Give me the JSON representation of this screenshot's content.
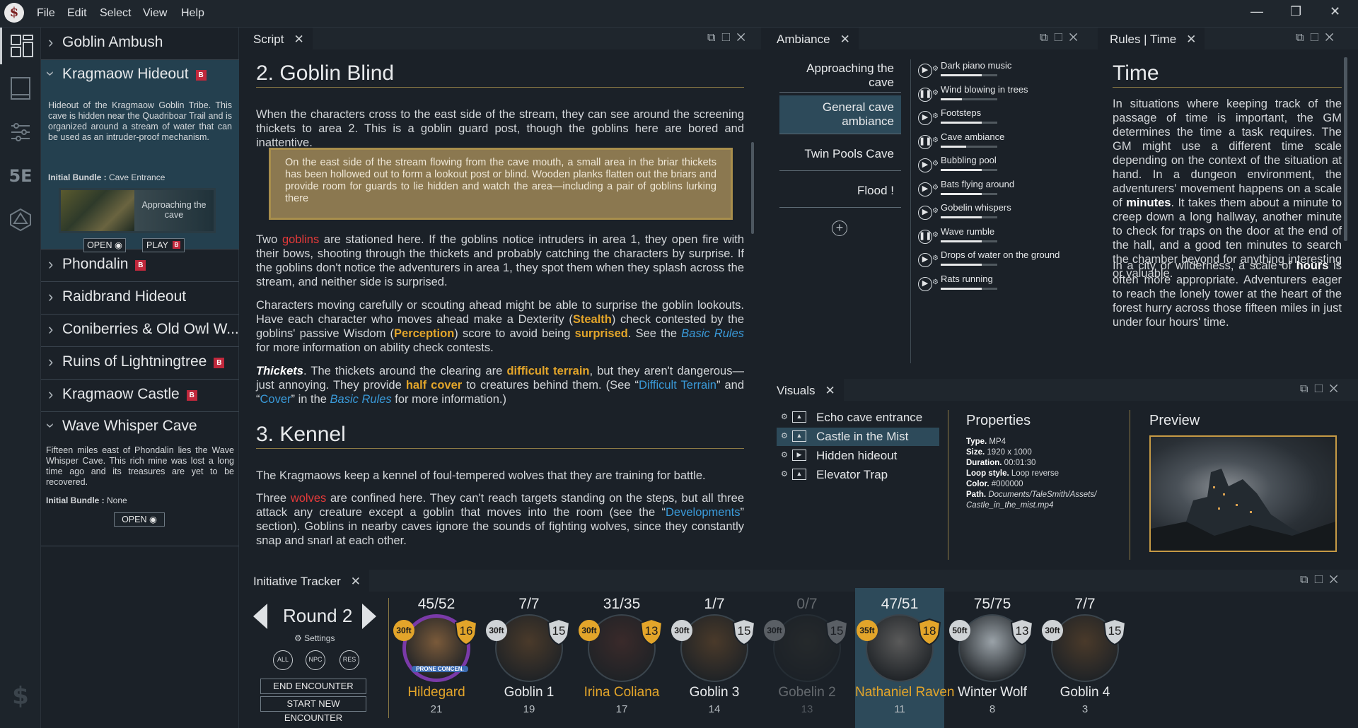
{
  "menubar": {
    "items": [
      "File",
      "Edit",
      "Select",
      "View",
      "Help"
    ],
    "logo": "$",
    "minimize": "—",
    "restore": "❐",
    "close": "✕"
  },
  "iconbar": {
    "icons": [
      "layout-icon",
      "book-icon",
      "sliders-icon",
      "5e-icon",
      "d20-icon",
      "logo-mark-icon"
    ],
    "fivee": "5E"
  },
  "sidebar": {
    "adventures": [
      {
        "title": "Goblin Ambush",
        "badge": false,
        "expanded": false
      },
      {
        "title": "Kragmaow Hideout",
        "badge": true,
        "expanded": true,
        "description": "Hideout of the Kragmaow Goblin Tribe. This cave is hidden near the Quadriboar Trail and is organized around a stream of water that can be used as an intruder-proof mechanism.",
        "bundle_label": "Initial Bundle :",
        "bundle_value": "Cave Entrance",
        "thumb_label": "Approaching the cave",
        "open": "OPEN",
        "play": "PLAY"
      },
      {
        "title": "Phondalin",
        "badge": true,
        "expanded": false
      },
      {
        "title": "Raidbrand Hideout",
        "badge": false,
        "expanded": false
      },
      {
        "title": "Coniberries & Old Owl W...",
        "badge": false,
        "expanded": false
      },
      {
        "title": "Ruins of Lightningtree",
        "badge": true,
        "expanded": false
      },
      {
        "title": "Kragmaow Castle",
        "badge": true,
        "expanded": false
      },
      {
        "title": "Wave Whisper Cave",
        "badge": false,
        "expanded": true,
        "description": "Fifteen miles east of Phondalin lies the Wave Whisper Cave. This rich mine was lost a long time ago and its treasures are yet to be recovered.",
        "bundle_label": "Initial Bundle :",
        "bundle_value": "None",
        "open": "OPEN"
      }
    ],
    "badge_letter": "B"
  },
  "script": {
    "tab": "Script",
    "h_goblin_blind": "2. Goblin Blind",
    "p1": "When the characters cross to the east side of the stream, they can see around the screening thickets to area 2. This is a goblin guard post, though the goblins here are bored and inattentive.",
    "box": "On the east side of the stream flowing from the cave mouth, a small area in the briar thickets has been hollowed out to form a lookout post or blind. Wooden planks flatten out the briars and provide room for guards to lie hidden and watch the area—including a pair of goblins lurking there",
    "p2a": "Two ",
    "p2kw": "goblins",
    "p2b": " are stationed here. If the goblins notice intruders in area 1, they open fire with their bows, shooting through the thickets and probably catching the characters by surprise. If the goblins don't notice the adventurers in area 1, they spot them when they splash across the stream, and neither side is surprised.",
    "p3a": "Characters moving carefully or scouting ahead might be able to surprise the goblin lookouts. Have each character who moves ahead make a Dexterity (",
    "p3s": "Stealth",
    "p3b": ") check contested by the goblins' passive Wisdom (",
    "p3p": "Perception",
    "p3c": ") score to avoid being ",
    "p3su": "surprised",
    "p3d": ". See the ",
    "p3l": "Basic Rules",
    "p3e": " for more information on ability check contests.",
    "p4t": "Thickets",
    "p4a": ". The thickets around the clearing are ",
    "p4d": "difficult terrain",
    "p4b": ", but they aren't dangerous—just annoying. They provide ",
    "p4h": "half cover",
    "p4c": " to creatures behind them. (See “",
    "p4l1": "Difficult Terrain",
    "p4e": "” and “",
    "p4l2": "Cover",
    "p4f": "” in the ",
    "p4l3": "Basic Rules",
    "p4g": " for more information.)",
    "h_kennel": "3. Kennel",
    "p5": "The Kragmaows keep a kennel of foul-tempered wolves that they are training for battle.",
    "p6a": "Three ",
    "p6kw": "wolves",
    "p6b": " are confined here. They can't reach targets standing on the steps, but all three attack any creature except a goblin that moves into the room (see the “",
    "p6l": "Developments",
    "p6c": "” section). Goblins in nearby caves ignore the sounds of fighting wolves, since they constantly snap and snarl at each other."
  },
  "ambiance": {
    "tab": "Ambiance",
    "scenes": [
      {
        "label": "Approaching the cave",
        "active": false
      },
      {
        "label": "General cave ambiance",
        "active": true
      },
      {
        "label": "Twin Pools Cave",
        "active": false
      },
      {
        "label": "Flood !",
        "active": false
      }
    ],
    "sounds": [
      {
        "name": "Dark piano music",
        "playing": false,
        "volume": 0.72
      },
      {
        "name": "Wind blowing in trees",
        "playing": true,
        "volume": 0.38
      },
      {
        "name": "Footsteps",
        "playing": false,
        "volume": 0.72
      },
      {
        "name": "Cave ambiance",
        "playing": true,
        "volume": 0.45
      },
      {
        "name": "Bubbling pool",
        "playing": false,
        "volume": 0.72
      },
      {
        "name": "Bats flying around",
        "playing": false,
        "volume": 0.72
      },
      {
        "name": "Gobelin whispers",
        "playing": false,
        "volume": 0.72
      },
      {
        "name": "Wave rumble",
        "playing": true,
        "volume": 0.72
      },
      {
        "name": "Drops of water on the ground",
        "playing": false,
        "volume": 0.72
      },
      {
        "name": "Rats running",
        "playing": false,
        "volume": 0.72
      }
    ]
  },
  "rules": {
    "tab": "Rules | Time",
    "title": "Time",
    "p1a": "In situations where keeping track of the passage of time is important, the GM determines the time a task requires. The GM might use a different time scale depending on the context of the situation at hand. In a dungeon environment, the adventurers' movement happens on a scale of ",
    "p1b": "minutes",
    "p1c": ". It takes them about a minute to creep down a long hallway, another minute to check for traps on the door at the end of the hall, and a good ten minutes to search the chamber beyond for anything interesting or valuable.",
    "p2a": "In a city or wilderness, a scale of ",
    "p2b": "hours",
    "p2c": " is often more appropriate. Adventurers eager to reach the lonely tower at the heart of the forest hurry across those fifteen miles in just under four hours' time."
  },
  "visuals": {
    "tab": "Visuals",
    "items": [
      {
        "label": "Echo cave entrance",
        "type": "image"
      },
      {
        "label": "Castle in the Mist",
        "type": "image",
        "selected": true
      },
      {
        "label": "Hidden hideout",
        "type": "video"
      },
      {
        "label": "Elevator Trap",
        "type": "image"
      }
    ],
    "properties_title": "Properties",
    "properties": [
      {
        "k": "Type.",
        "v": "MP4"
      },
      {
        "k": "Size.",
        "v": "1920 x 1000"
      },
      {
        "k": "Duration.",
        "v": "00:01:30"
      },
      {
        "k": "Loop style.",
        "v": "Loop reverse"
      },
      {
        "k": "Color.",
        "v": "#000000"
      },
      {
        "k": "Path.",
        "v": "Documents/TaleSmith/Assets/ Castle_in_the_mist.mp4"
      }
    ],
    "preview_title": "Preview"
  },
  "initiative": {
    "tab": "Initiative Tracker",
    "round": "Round 2",
    "settings": "Settings",
    "filters": [
      "ALL",
      "NPC",
      "RES"
    ],
    "end": "END ENCOUNTER",
    "start": "START NEW ENCOUNTER",
    "combatants": [
      {
        "hp": "45/52",
        "speed": "30ft",
        "ac": "16",
        "name": "Hildegard",
        "init": "21",
        "pc": true,
        "dim": false,
        "active": false,
        "conditions": "PRONE  CONCEN."
      },
      {
        "hp": "7/7",
        "speed": "30ft",
        "ac": "15",
        "name": "Goblin 1",
        "init": "19",
        "pc": false,
        "dim": false,
        "active": false
      },
      {
        "hp": "31/35",
        "speed": "30ft",
        "ac": "13",
        "name": "Irina Coliana",
        "init": "17",
        "pc": true,
        "dim": false,
        "active": false
      },
      {
        "hp": "1/7",
        "speed": "30ft",
        "ac": "15",
        "name": "Goblin 3",
        "init": "14",
        "pc": false,
        "dim": false,
        "active": false
      },
      {
        "hp": "0/7",
        "speed": "30ft",
        "ac": "15",
        "name": "Gobelin 2",
        "init": "13",
        "pc": false,
        "dim": true,
        "active": false
      },
      {
        "hp": "47/51",
        "speed": "35ft",
        "ac": "18",
        "name": "Nathaniel Raven",
        "init": "11",
        "pc": true,
        "dim": false,
        "active": true
      },
      {
        "hp": "75/75",
        "speed": "50ft",
        "ac": "13",
        "name": "Winter Wolf",
        "init": "8",
        "pc": false,
        "dim": false,
        "active": false
      },
      {
        "hp": "7/7",
        "speed": "30ft",
        "ac": "15",
        "name": "Goblin 4",
        "init": "3",
        "pc": false,
        "dim": false,
        "active": false
      }
    ]
  },
  "colors": {
    "accent": "#2d4a5a",
    "gold": "#e3a52a",
    "keyword": "#e43a3a",
    "link": "#3a9ad9",
    "badge": "#c0283c"
  }
}
